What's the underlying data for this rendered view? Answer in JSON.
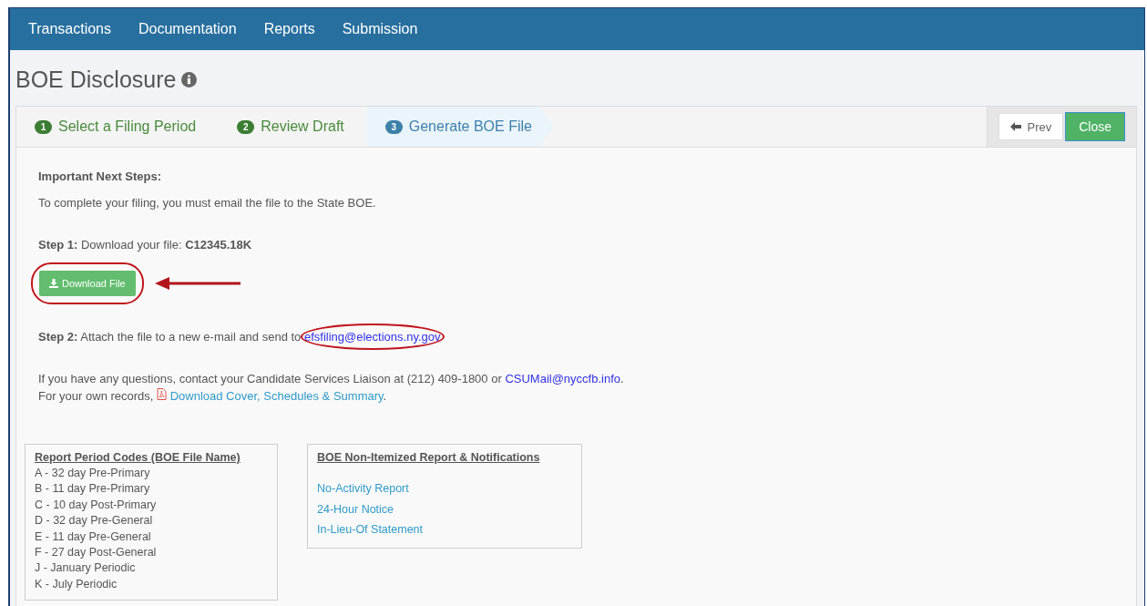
{
  "nav": {
    "items": [
      "Transactions",
      "Documentation",
      "Reports",
      "Submission"
    ]
  },
  "page": {
    "title": "BOE Disclosure"
  },
  "steps": [
    {
      "number": "1",
      "label": "Select a Filing Period",
      "selected": false
    },
    {
      "number": "2",
      "label": "Review Draft",
      "selected": false
    },
    {
      "number": "3",
      "label": "Generate BOE File",
      "selected": true
    }
  ],
  "toolbar": {
    "prev": "Prev",
    "close": "Close"
  },
  "content": {
    "heading": "Important Next Steps:",
    "intro": "To complete your filing, you must email the file to the State BOE.",
    "step1": "**Step 1:** Download your file: **C12345.18K**",
    "download_button": "Download File",
    "step2": "**Step 2:** Attach the file to a new e-mail and send to",
    "step2_email": "efsfiling@elections.ny.gov",
    "contact": "If you have any questions, contact your Candidate Services Liaison at (212) 409-1800 or",
    "contact_email": "CSUMail@nyccfb.info",
    "contact_end": ".",
    "records": "For your own records,",
    "records_link": "Download Cover, Schedules & Summary",
    "records_end": "."
  },
  "codes": {
    "title": "Report Period Codes (BOE File Name)",
    "items": [
      "A - 32 day Pre-Primary",
      "B - 11 day Pre-Primary",
      "C - 10 day Post-Primary",
      "D - 32 day Pre-General",
      "E - 11 day Pre-General",
      "F - 27 day Post-General",
      "J - January Periodic",
      "K - July Periodic"
    ]
  },
  "notifications": {
    "title": "BOE Non-Itemized Report & Notifications",
    "links": [
      "No-Activity Report",
      "24-Hour Notice",
      "In-Lieu-Of Statement"
    ]
  }
}
